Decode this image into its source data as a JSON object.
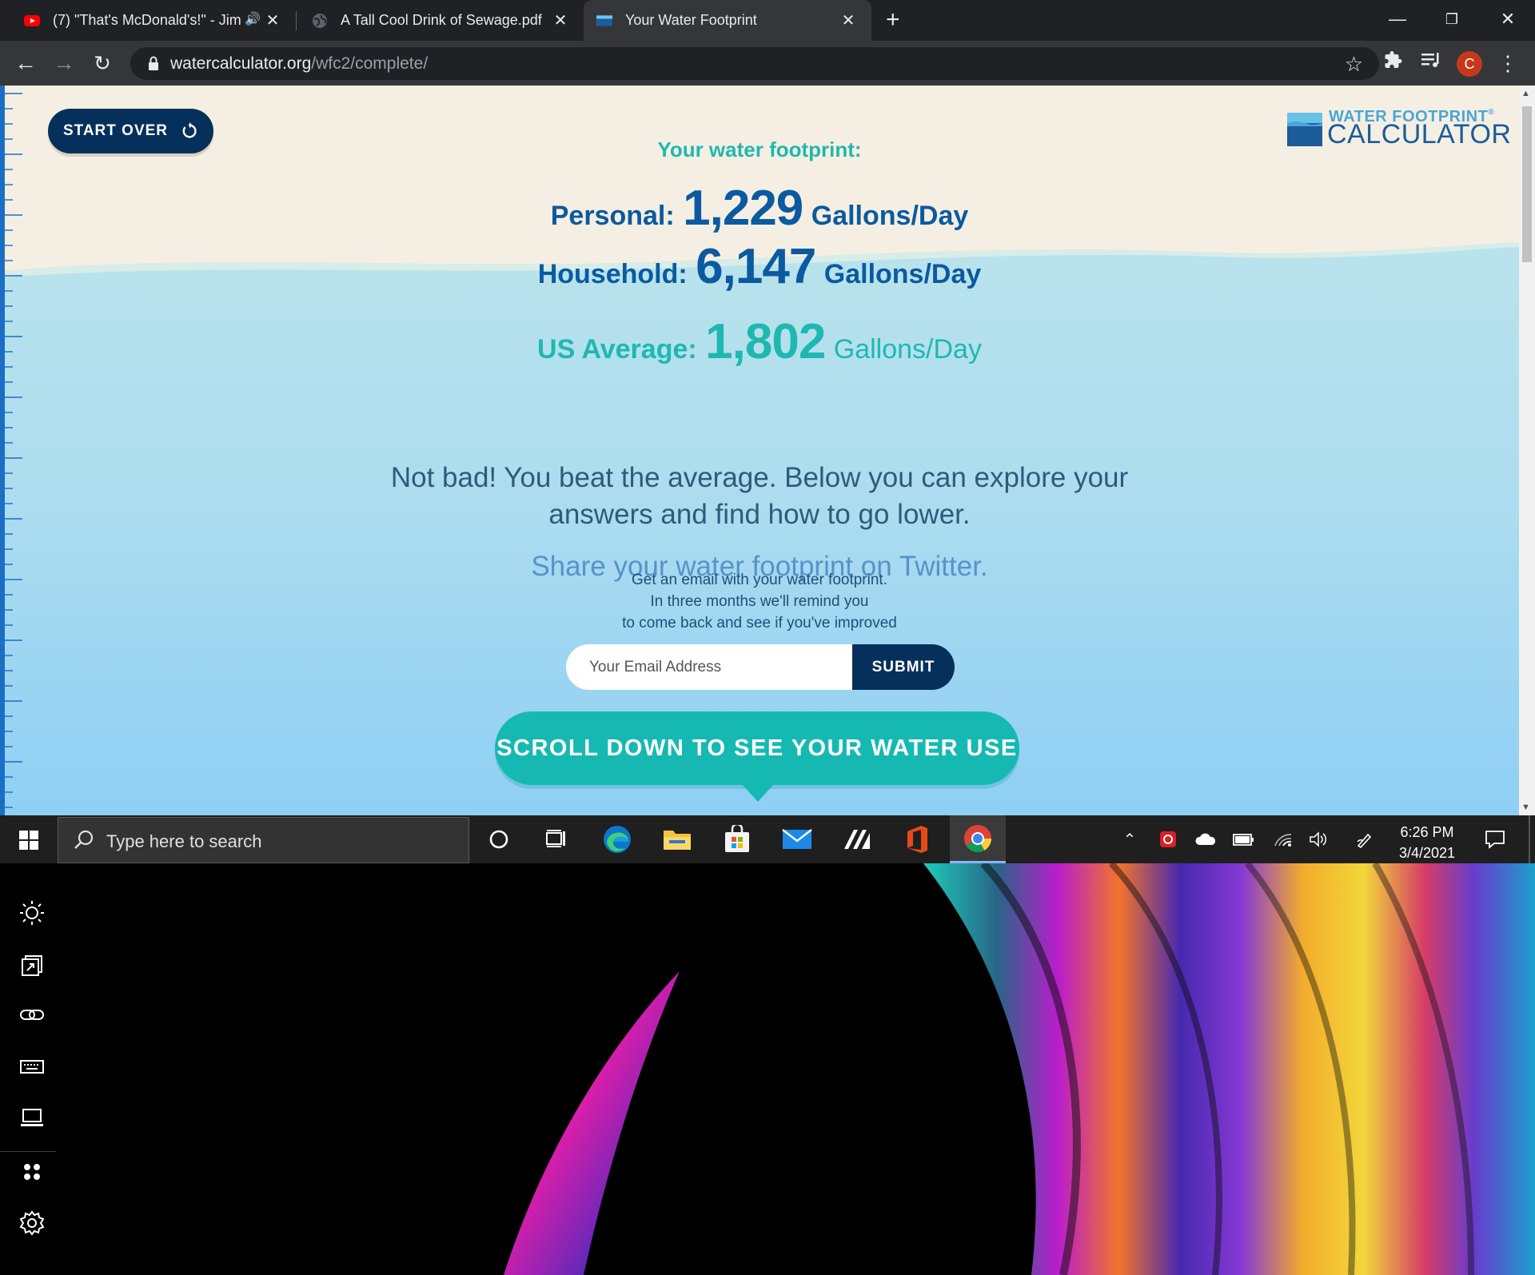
{
  "browser": {
    "tabs": [
      {
        "title": "(7) \"That's McDonald's!\" - Jim",
        "favicon": "youtube-icon",
        "muted_icon": "speaker-icon"
      },
      {
        "title": "A Tall Cool Drink of Sewage.pdf",
        "favicon": "globe-icon"
      },
      {
        "title": "Your Water Footprint",
        "favicon": "water-favicon",
        "active": true
      }
    ],
    "address": {
      "domain": "watercalculator.org",
      "path": "/wfc2/complete/"
    },
    "avatar_letter": "C"
  },
  "page": {
    "start_over_label": "START OVER",
    "logo": {
      "top": "WATER FOOTPRINT",
      "bottom": "CALCULATOR",
      "mark": "®"
    },
    "heading": "Your water footprint:",
    "personal": {
      "label": "Personal:",
      "value": "1,229",
      "unit": "Gallons/Day"
    },
    "household": {
      "label": "Household:",
      "value": "6,147",
      "unit": "Gallons/Day"
    },
    "us_average": {
      "label": "US Average:",
      "value": "1,802",
      "unit": "Gallons/Day"
    },
    "message_line1": "Not bad! You beat the average. Below you can explore your",
    "message_line2": "answers and find how to go lower.",
    "share_link": "Share your water footprint on Twitter.",
    "email_pitch_line1": "Get an email with your water footprint.",
    "email_pitch_line2": "In three months we'll remind you",
    "email_pitch_line3": "to come back and see if you've improved",
    "email_placeholder": "Your Email Address",
    "submit_label": "SUBMIT",
    "scroll_label": "SCROLL DOWN TO SEE YOUR WATER USE",
    "colors": {
      "navy": "#06305c",
      "blue": "#0b5aa0",
      "teal": "#16b9b2",
      "sand": "#f5efe3",
      "water": "#8fd0f2"
    }
  },
  "taskbar": {
    "search_placeholder": "Type here to search",
    "time": "6:26 PM",
    "date": "3/4/2021",
    "apps": [
      "cortana-icon",
      "task-view-icon",
      "edge-icon",
      "file-explorer-icon",
      "store-icon",
      "mail-icon",
      "app-icon",
      "office-icon",
      "chrome-icon"
    ]
  }
}
